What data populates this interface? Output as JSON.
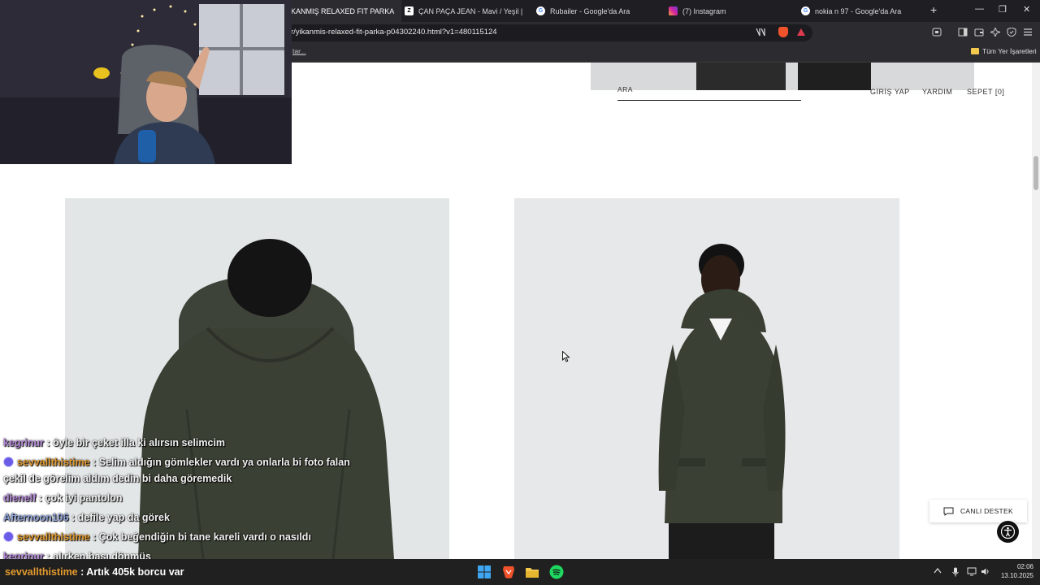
{
  "browser": {
    "tabs": [
      {
        "label": "KANMIŞ RELAXED FIT PARKA",
        "active": true,
        "favicon": "zara-favicon"
      },
      {
        "label": "ÇAN PAÇA JEAN - Mavi / Yeşil | ZARA",
        "active": false,
        "favicon": "zara-favicon"
      },
      {
        "label": "Rubailer - Google'da Ara",
        "active": false,
        "favicon": "google-favicon"
      },
      {
        "label": "(7) Instagram",
        "active": false,
        "favicon": "instagram-favicon"
      },
      {
        "label": "nokia n 97 - Google'da Ara",
        "active": false,
        "favicon": "google-favicon"
      }
    ],
    "tab_close": "✕",
    "new_tab": "+",
    "window_controls": {
      "minimize": "—",
      "restore": "❐",
      "close": "✕"
    },
    "url": "r/yikanmis-relaxed-fit-parka-p04302240.html?v1=480115124",
    "bookmarks_left": "tar...",
    "bookmarks_right": "Tüm Yer İşaretleri"
  },
  "site": {
    "search_label": "ARA",
    "nav": {
      "login": "GİRİŞ YAP",
      "help": "YARDIM",
      "cart": "SEPET [0]"
    },
    "live_support": "CANLI DESTEK"
  },
  "chat": [
    {
      "user": "kegrinur",
      "user_color": "#b48ad8",
      "badge": false,
      "text": " : öyle bir çeket illa ki alırsın selimcim"
    },
    {
      "user": "sevvallthistime",
      "user_color": "#e39a2d",
      "badge": true,
      "text": " : Selim aldığın gömlekler vardı ya onlarla bi foto falan"
    },
    {
      "user": "",
      "user_color": "#f2f2f2",
      "badge": false,
      "text": "çekil de görelim aldım dedin bi daha göremedik"
    },
    {
      "user": "dienelf",
      "user_color": "#b48ad8",
      "badge": false,
      "text": " : çok iyi pantolon"
    },
    {
      "user": "Afternoon106",
      "user_color": "#8fa3d8",
      "badge": false,
      "text": " : defile yap da görek"
    },
    {
      "user": "sevvallthistime",
      "user_color": "#e39a2d",
      "badge": true,
      "text": " : Çok beğendiğin bi tane kareli vardı o nasıldı"
    },
    {
      "user": "kegrinur",
      "user_color": "#b48ad8",
      "badge": false,
      "text": " : alırken başı dönmüş"
    }
  ],
  "taskbar": {
    "ticker_user": "sevvallthistime",
    "ticker_text": " : Artık 405k borcu var",
    "ticker_user_color": "#e39a2d",
    "apps": [
      "windows-start-icon",
      "brave-browser-icon",
      "file-explorer-icon",
      "spotify-icon"
    ],
    "time": "02:06",
    "date": "13.10.2025"
  },
  "colors": {
    "accent_dark": "#1f1f23",
    "jacket_green": "#3b4034"
  }
}
